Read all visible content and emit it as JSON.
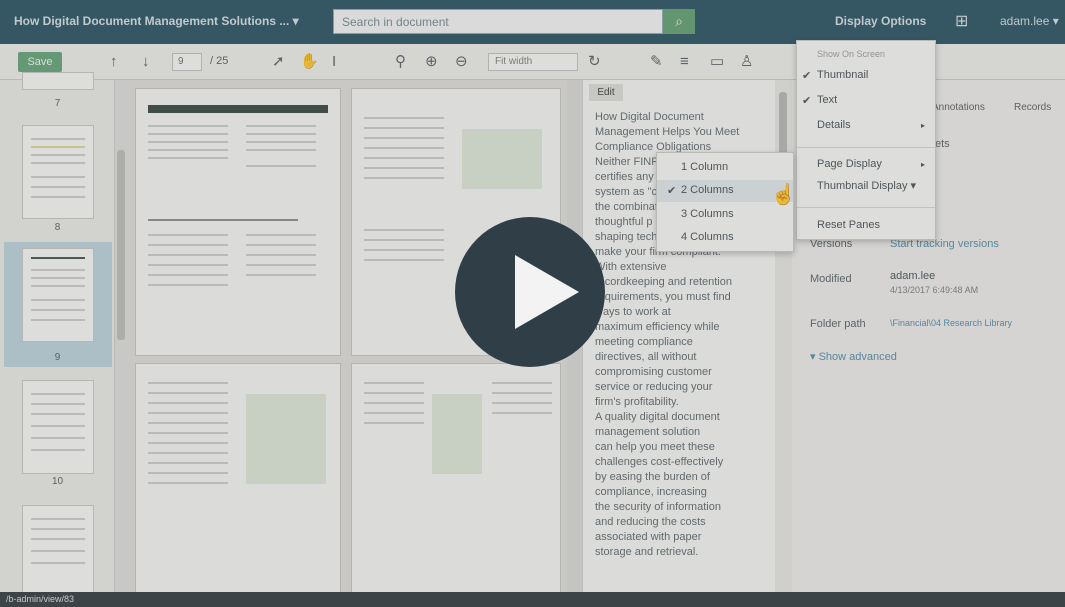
{
  "topbar": {
    "doc_title": "How Digital Document Management Solutions ... ▾",
    "search_placeholder": "Search in document",
    "search_icon": "search-icon",
    "display_options": "Display Options",
    "grid_icon": "apps-grid-icon",
    "user": "adam.lee ▾"
  },
  "toolbar": {
    "save": "Save",
    "page_current": "9",
    "page_total": "/ 25",
    "fit": "Fit width"
  },
  "thumbnails": {
    "labels": [
      "7",
      "8",
      "9",
      "10"
    ]
  },
  "text_panel": {
    "edit": "Edit",
    "body": "How Digital Document\nManagement Helps You Meet\nCompliance Obligations\nNeither FINRA\ncertifies any\nsystem as \"c\nthe combination\nthoughtful p\nshaping tech\nmake your firm compliant.\nWith extensive\nrecordkeeping and retention\nrequirements, you must find\nways to work at\nmaximum efficiency while\nmeeting compliance\ndirectives, all without\ncompromising customer\nservice or reducing your\nfirm's profitability.\nA quality digital document\nmanagement solution\ncan help you meet these\nchallenges cost-effectively\nby easing the burden of\ncompliance, increasing\nthe security of information\nand reducing the costs\nassociated with paper\nstorage and retrieval."
  },
  "menu": {
    "head": "Show On Screen",
    "items": [
      "Thumbnail",
      "Text",
      "Details",
      "Page Display",
      "Thumbnail Display ▾",
      "Reset Panes"
    ]
  },
  "submenu": {
    "items": [
      "1 Column",
      "2 Columns",
      "3 Columns",
      "4 Columns"
    ]
  },
  "props": {
    "tab1": "Annotations",
    "tab2": "Records",
    "partial": "ets",
    "versions_label": "Versions",
    "versions_val": "Start tracking versions",
    "modified_label": "Modified",
    "modified_user": "adam.lee",
    "modified_date": "4/13/2017 6:49:48 AM",
    "folder_label": "Folder path",
    "folder_val": "\\Financial\\04 Research Library",
    "advanced": "Show advanced"
  },
  "status": "/b-admin/view/83",
  "colors": {
    "topbar": "#1f4a5c",
    "save": "#5d9e72",
    "play": "#2f3e47"
  }
}
